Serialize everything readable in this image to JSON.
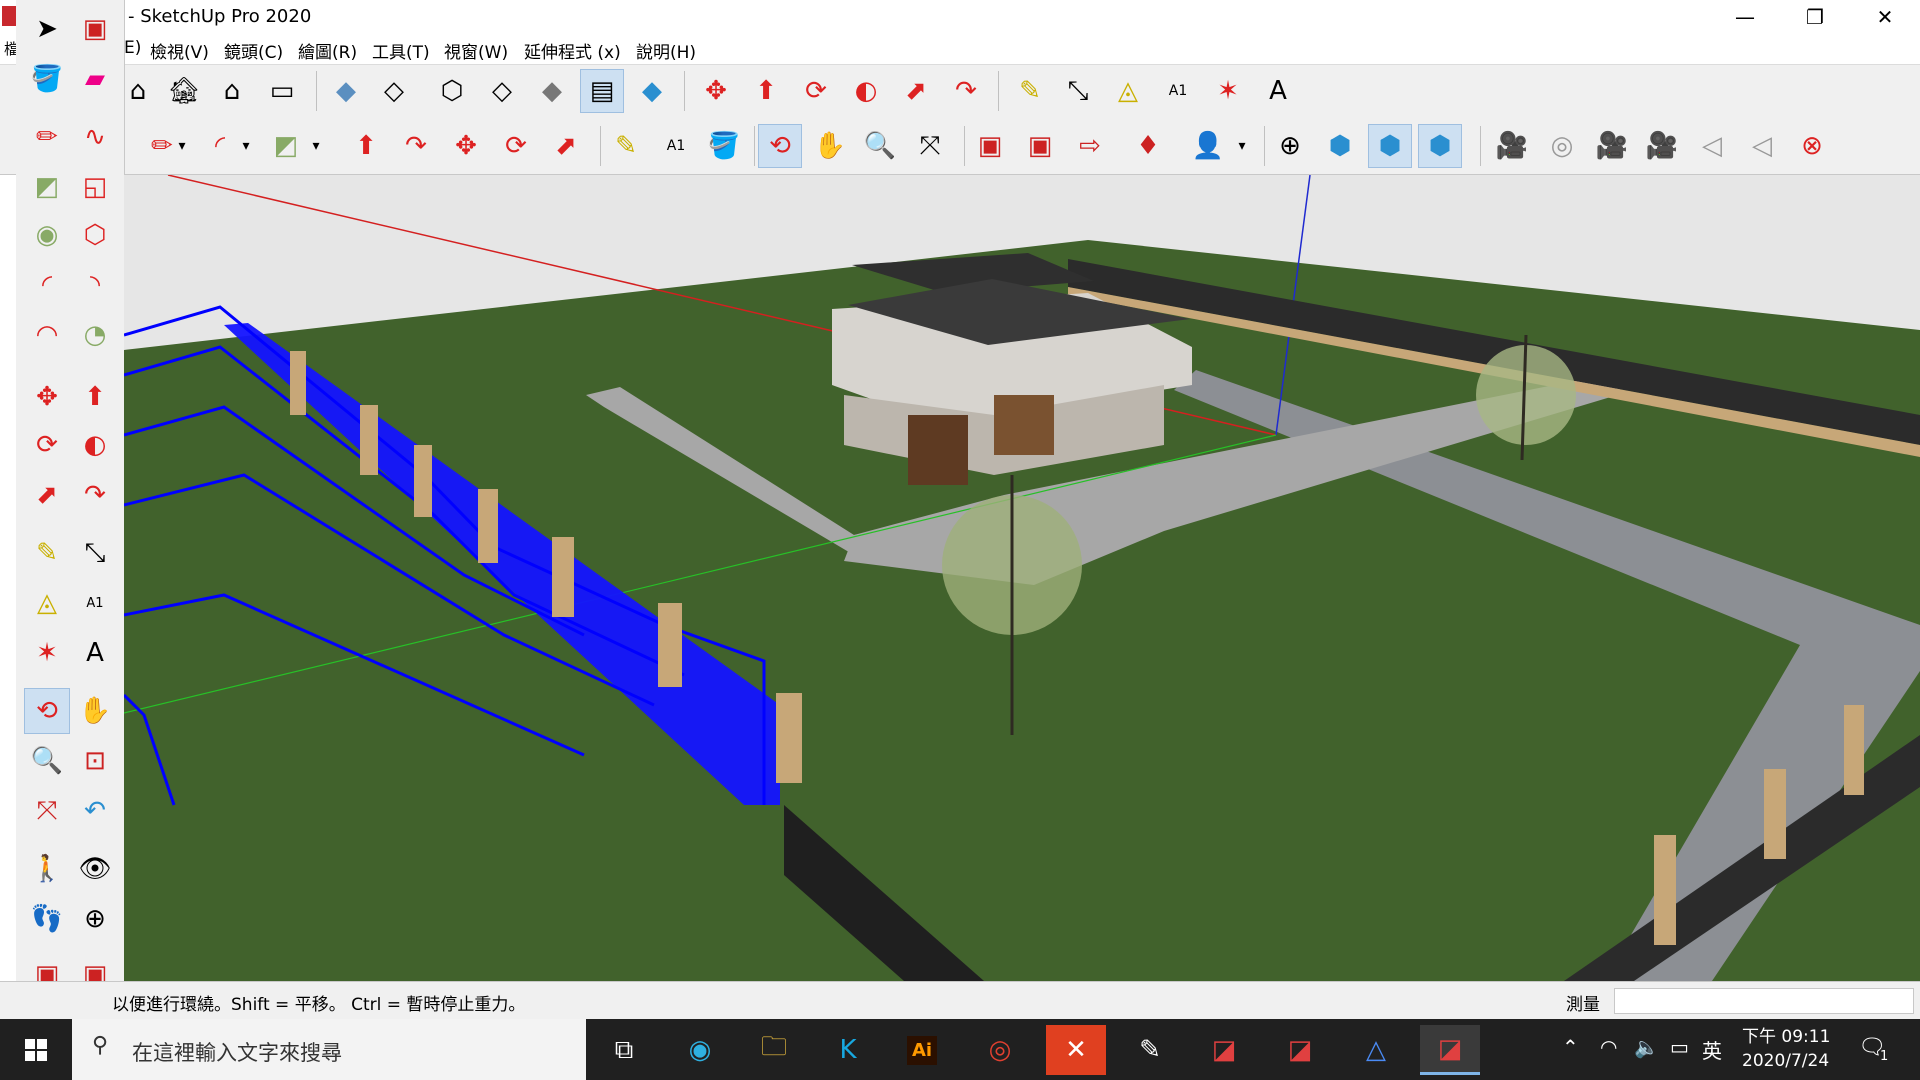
{
  "window": {
    "title": "- SketchUp Pro 2020",
    "minimize": "—",
    "restore": "❐",
    "close": "✕"
  },
  "menu": [
    {
      "label": "E)"
    },
    {
      "label": "檢視(V)"
    },
    {
      "label": "鏡頭(C)"
    },
    {
      "label": "繪圖(R)"
    },
    {
      "label": "工具(T)"
    },
    {
      "label": "視窗(W)"
    },
    {
      "label": "延伸程式 (x)"
    },
    {
      "label": "說明(H)"
    }
  ],
  "left_clip": {
    "top_char": "檔"
  },
  "status": {
    "hint": "以便進行環繞。Shift = 平移。 Ctrl = 暫時停止重力。",
    "measure_label": "測量",
    "measure_value": ""
  },
  "toolbar_texts": {
    "text_tool": "A1",
    "dim_tool": "A1"
  },
  "taskbar": {
    "search_placeholder": "在這裡輸入文字來搜尋",
    "illustrator_label": "Ai",
    "ime": "英",
    "time": "下午 09:11",
    "date": "2020/7/24",
    "notification_count": "1"
  },
  "colors": {
    "grass": "#3f5f2a",
    "sky": "#e8e8e8",
    "selection": "#0000ff",
    "path": "#9a9a9a",
    "road": "#8c8f94"
  }
}
